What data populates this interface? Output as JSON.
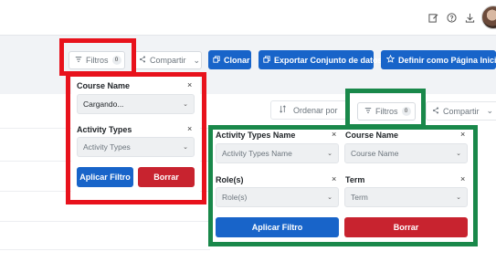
{
  "header": {
    "icons": [
      "note-edit-icon",
      "help-icon",
      "download-icon"
    ]
  },
  "toolbar": {
    "filters_label": "Filtros",
    "filters_count": "0",
    "share_label": "Compartir",
    "clone_label": "Clonar",
    "export_label": "Exportar Conjunto de datos",
    "set_home_label": "Definir como Página Inicial"
  },
  "table_toolbar": {
    "sort_label": "Ordenar por",
    "filters_label": "Filtros",
    "filters_count": "0",
    "share_label": "Compartir"
  },
  "filter_panel_1": {
    "course_name": {
      "label": "Course Name",
      "value": "Cargando..."
    },
    "activity_types": {
      "label": "Activity Types",
      "placeholder": "Activity Types"
    },
    "apply_label": "Aplicar Filtro",
    "clear_label": "Borrar"
  },
  "filter_panel_2": {
    "activity_types_name": {
      "label": "Activity Types Name",
      "placeholder": "Activity Types Name"
    },
    "course_name": {
      "label": "Course Name",
      "placeholder": "Course Name"
    },
    "roles": {
      "label": "Role(s)",
      "placeholder": "Role(s)"
    },
    "term": {
      "label": "Term",
      "placeholder": "Term"
    },
    "apply_label": "Aplicar Filtro",
    "clear_label": "Borrar"
  },
  "colors": {
    "primary": "#1864c9",
    "danger": "#c8232f",
    "highlight_red": "#e8121c",
    "highlight_green": "#19884a"
  }
}
